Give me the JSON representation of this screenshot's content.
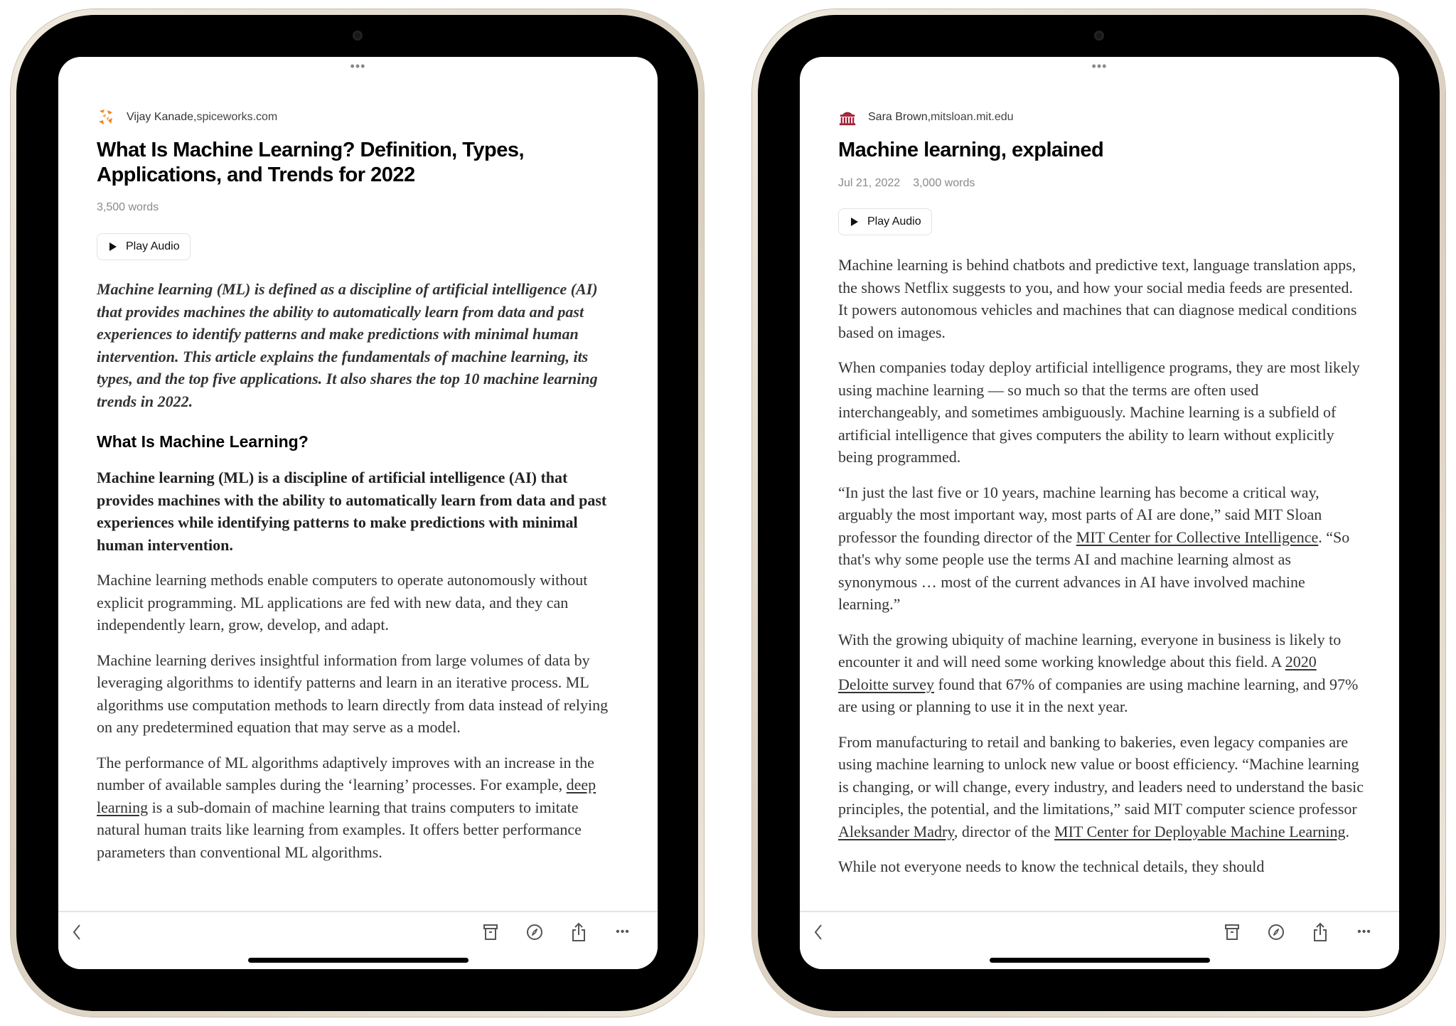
{
  "left": {
    "byline": {
      "author": "Vijay Kanade,",
      "source": " spiceworks.com",
      "logo_icon": "spiceworks-logo",
      "logo_color": "#f5821f"
    },
    "title": "What Is Machine Learning? Definition, Types, Applications, and Trends for 2022",
    "meta": {
      "words": "3,500 words"
    },
    "play_audio": "Play Audio",
    "intro": "Machine learning (ML) is defined as a discipline of artificial intelligence (AI) that provides machines the ability to automatically learn from data and past experiences to identify patterns and make predictions with minimal human intervention. This article explains the fundamentals of machine learning, its types, and the top five applications. It also shares the top 10 machine learning trends in 2022.",
    "heading": "What Is Machine Learning?",
    "lead": "Machine learning (ML) is a discipline of artificial intelligence (AI) that provides machines with the ability to automatically learn from data and past experiences while identifying patterns to make predictions with minimal human intervention.",
    "paragraphs": [
      [
        {
          "t": "Machine learning methods enable computers to operate autonomously without explicit programming. ML applications are fed with new data, and they can independently learn, grow, develop, and adapt."
        }
      ],
      [
        {
          "t": "Machine learning derives insightful information from large volumes of data by leveraging algorithms to identify patterns and learn in an iterative process. ML algorithms use computation methods to learn directly from data instead of relying on any predetermined equation that may serve as a model."
        }
      ],
      [
        {
          "t": "The performance of ML algorithms adaptively improves with an increase in the number of available samples during the ‘learning’ processes. For example, "
        },
        {
          "t": "deep learning",
          "link": true
        },
        {
          "t": " is a sub-domain of machine learning that trains computers to imitate natural human traits like learning from examples. It offers better performance parameters than conventional ML algorithms."
        }
      ]
    ]
  },
  "right": {
    "byline": {
      "author": "Sara Brown,",
      "source": " mitsloan.mit.edu",
      "logo_icon": "mit-dome-logo",
      "logo_color": "#a31f34"
    },
    "title": "Machine learning, explained",
    "meta": {
      "date": "Jul 21, 2022",
      "words": "3,000 words"
    },
    "play_audio": "Play Audio",
    "paragraphs": [
      [
        {
          "t": "Machine learning is behind chatbots and predictive text, language translation apps, the shows Netflix suggests to you, and how your social media feeds are presented. It powers autonomous vehicles and machines that can diagnose medical conditions based on images."
        }
      ],
      [
        {
          "t": "When companies today deploy artificial intelligence programs, they are most likely using machine learning — so much so that the terms are often used interchangeably, and sometimes ambiguously. Machine learning is a subfield of artificial intelligence that gives computers the ability to learn without explicitly being programmed."
        }
      ],
      [
        {
          "t": "“In just the last five or 10 years, machine learning has become a critical way, arguably the most important way, most parts of AI are done,” said MIT Sloan professor the founding director of the "
        },
        {
          "t": "MIT Center for Collective Intelligence",
          "link": true
        },
        {
          "t": ". “So that's why some people use the terms AI and machine learning almost as synonymous … most of the current advances in AI have involved machine learning.”"
        }
      ],
      [
        {
          "t": "With the growing ubiquity of machine learning, everyone in business is likely to encounter it and will need some working knowledge about this field. A "
        },
        {
          "t": "2020 Deloitte survey",
          "link": true
        },
        {
          "t": " found that 67% of companies are using machine learning, and 97% are using or planning to use it in the next year."
        }
      ],
      [
        {
          "t": "From manufacturing to retail and banking to bakeries, even legacy companies are using machine learning to unlock new value or boost efficiency. “Machine learning is changing, or will change, every industry, and leaders need to understand the basic principles, the potential, and the limitations,” said MIT computer science professor "
        },
        {
          "t": "Aleksander Madry",
          "link": true
        },
        {
          "t": ", director of the "
        },
        {
          "t": "MIT Center for Deployable Machine Learning",
          "link": true
        },
        {
          "t": "."
        }
      ],
      [
        {
          "t": "While not everyone needs to know the technical details, they should"
        }
      ]
    ]
  },
  "toolbar": {
    "icons": [
      "back-chevron-icon",
      "archive-icon",
      "compass-icon",
      "share-icon",
      "more-icon"
    ],
    "grabber": "•••",
    "more": "•••"
  }
}
